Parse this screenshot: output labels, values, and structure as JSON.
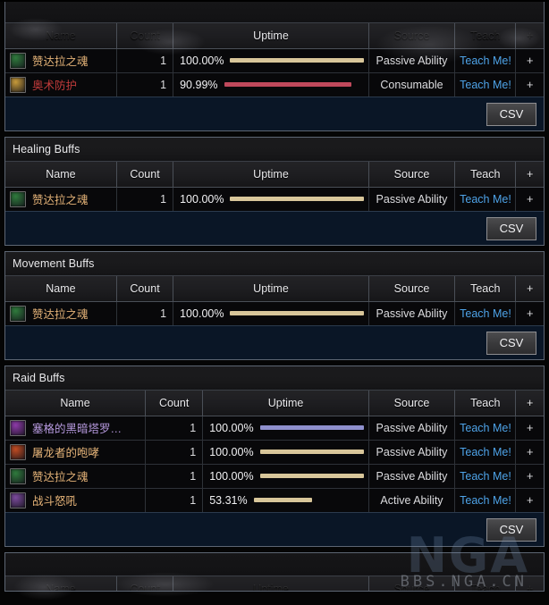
{
  "columns": {
    "name": "Name",
    "count": "Count",
    "uptime": "Uptime",
    "source": "Source",
    "teach": "Teach",
    "plus": "+"
  },
  "buttons": {
    "csv": "CSV"
  },
  "watermark": {
    "big": "NGA",
    "small": "BBS.NGA.CN"
  },
  "colors": {
    "bar_tan": "#d8c69a",
    "bar_red": "#c0495c",
    "bar_purple": "#8f90ce",
    "teach_link": "#4ea3e8",
    "panel_border": "#5d6673",
    "footer_bg": "#0a1626"
  },
  "sections": [
    {
      "id": "clipped-top",
      "title": "",
      "clipped": true,
      "header_faded": true,
      "rows": [
        {
          "name": "赞达拉之魂",
          "name_color": "#e5b378",
          "icon_color": "#2f7a3c",
          "count": "1",
          "uptime_pct": "100.00%",
          "uptime_value": 100.0,
          "bar_color": "#d8c69a",
          "source": "Passive Ability",
          "teach": "Teach Me!",
          "plus": "+"
        },
        {
          "name": "奥术防护",
          "name_color": "#c23b3b",
          "icon_color": "#c79a3a",
          "count": "1",
          "uptime_pct": "90.99%",
          "uptime_value": 90.99,
          "bar_color": "#c0495c",
          "source": "Consumable",
          "teach": "Teach Me!",
          "plus": "+"
        }
      ]
    },
    {
      "id": "healing-buffs",
      "title": "Healing Buffs",
      "clipped": false,
      "header_faded": false,
      "rows": [
        {
          "name": "赞达拉之魂",
          "name_color": "#e5b378",
          "icon_color": "#2f7a3c",
          "count": "1",
          "uptime_pct": "100.00%",
          "uptime_value": 100.0,
          "bar_color": "#d8c69a",
          "source": "Passive Ability",
          "teach": "Teach Me!",
          "plus": "+"
        }
      ]
    },
    {
      "id": "movement-buffs",
      "title": "Movement Buffs",
      "clipped": false,
      "header_faded": false,
      "rows": [
        {
          "name": "赞达拉之魂",
          "name_color": "#e5b378",
          "icon_color": "#2f7a3c",
          "count": "1",
          "uptime_pct": "100.00%",
          "uptime_value": 100.0,
          "bar_color": "#d8c69a",
          "source": "Passive Ability",
          "teach": "Teach Me!",
          "plus": "+"
        }
      ]
    },
    {
      "id": "raid-buffs",
      "title": "Raid Buffs",
      "clipped": false,
      "header_faded": false,
      "wide_name": true,
      "rows": [
        {
          "name": "塞格的黑暗塔罗…",
          "name_color": "#b79adf",
          "icon_color": "#8d3aa8",
          "count": "1",
          "uptime_pct": "100.00%",
          "uptime_value": 100.0,
          "bar_color": "#8f90ce",
          "source": "Passive Ability",
          "teach": "Teach Me!",
          "plus": "+"
        },
        {
          "name": "屠龙者的咆哮",
          "name_color": "#e5b378",
          "icon_color": "#c04b22",
          "count": "1",
          "uptime_pct": "100.00%",
          "uptime_value": 100.0,
          "bar_color": "#d8c69a",
          "source": "Passive Ability",
          "teach": "Teach Me!",
          "plus": "+"
        },
        {
          "name": "赞达拉之魂",
          "name_color": "#e5b378",
          "icon_color": "#2f7a3c",
          "count": "1",
          "uptime_pct": "100.00%",
          "uptime_value": 100.0,
          "bar_color": "#d8c69a",
          "source": "Passive Ability",
          "teach": "Teach Me!",
          "plus": "+"
        },
        {
          "name": "战斗怒吼",
          "name_color": "#e5b378",
          "icon_color": "#7b4a9c",
          "count": "1",
          "uptime_pct": "53.31%",
          "uptime_value": 53.31,
          "bar_color": "#d8c69a",
          "source": "Active Ability",
          "teach": "Teach Me!",
          "plus": "+"
        }
      ]
    },
    {
      "id": "clipped-bottom",
      "title": "",
      "clipped_bottom": true,
      "header_faded": true,
      "rows": []
    }
  ]
}
